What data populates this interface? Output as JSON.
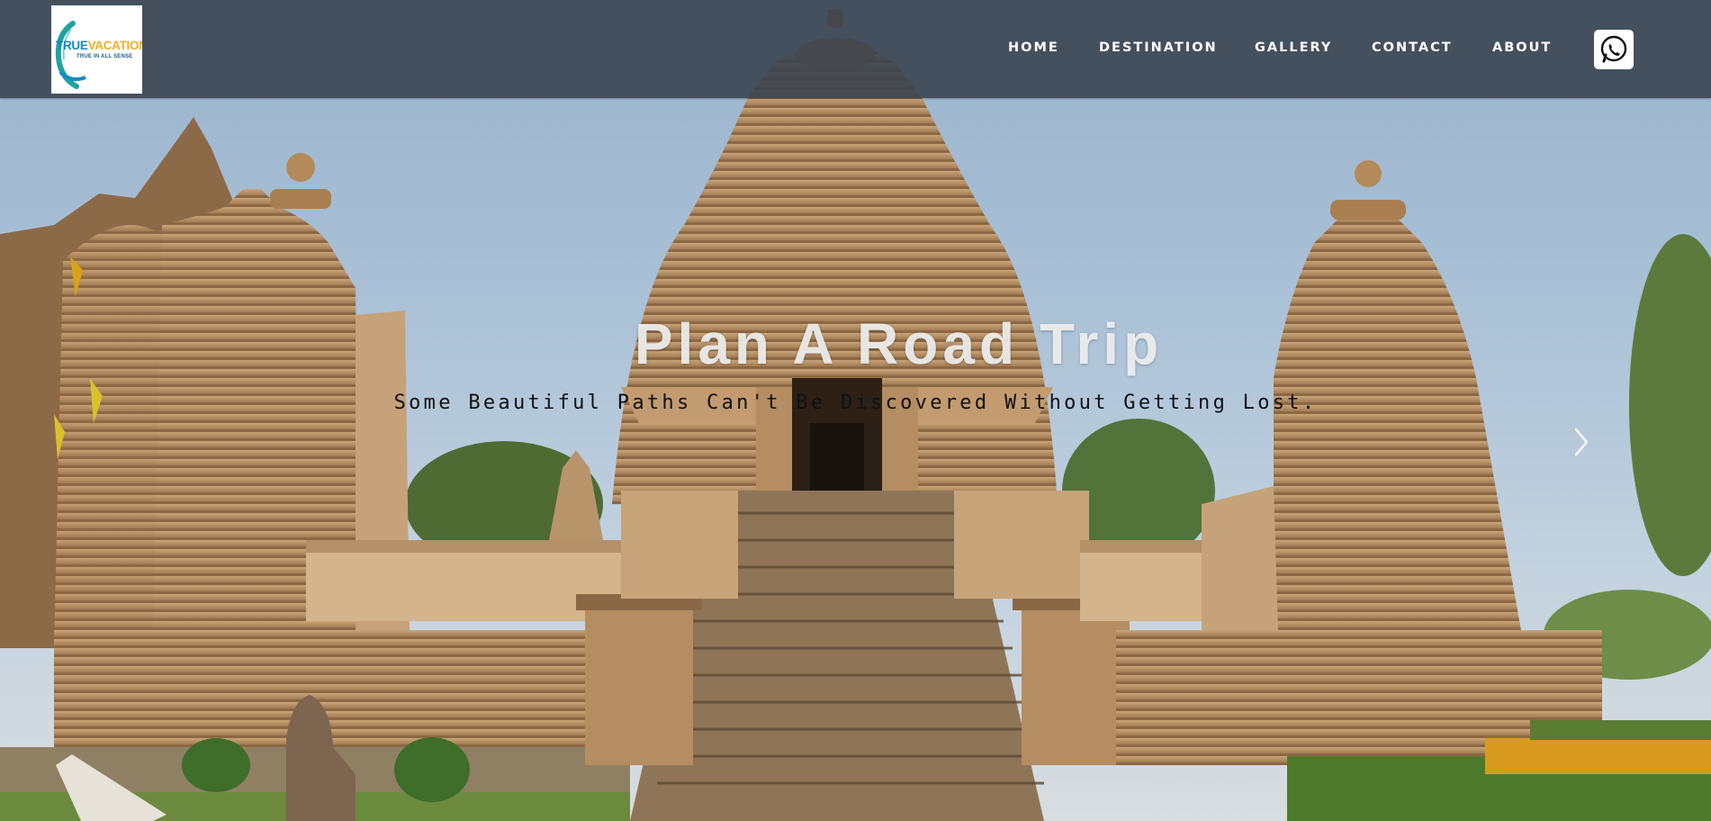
{
  "brand": {
    "logo_word_1": "TRUE",
    "logo_word_2": "VACATION",
    "logo_tagline": "TRUE IN ALL SENSE"
  },
  "nav": {
    "items": [
      {
        "label": "HOME"
      },
      {
        "label": "DESTINATION"
      },
      {
        "label": "GALLERY"
      },
      {
        "label": "CONTACT"
      },
      {
        "label": "ABOUT"
      }
    ],
    "whatsapp_icon": "whatsapp-icon"
  },
  "hero": {
    "title": "Plan A Road Trip",
    "subtitle": "Some Beautiful Paths Can't Be Discovered Without Getting Lost.",
    "next_icon": "chevron-right-icon"
  },
  "colors": {
    "navbar_bg": "#38424e",
    "nav_text": "#ffffff",
    "logo_blue": "#1689c9",
    "logo_yellow": "#f2b01e",
    "sandstone": "#c39a6b"
  }
}
